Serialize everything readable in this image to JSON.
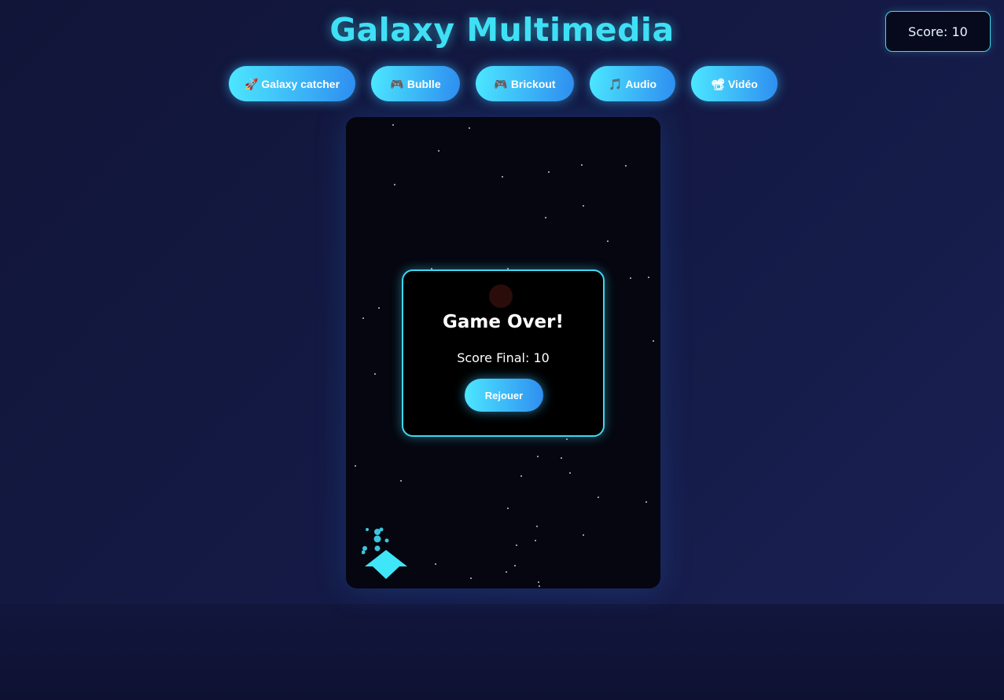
{
  "app": {
    "title": "Galaxy Multimedia",
    "score_label": "Score: 10"
  },
  "nav": {
    "items": [
      {
        "icon": "rocket-icon",
        "glyph": "🚀",
        "label": "Galaxy catcher"
      },
      {
        "icon": "gamepad-icon",
        "glyph": "🎮",
        "label": "Bublle"
      },
      {
        "icon": "gamepad-icon",
        "glyph": "🎮",
        "label": "Brickout"
      },
      {
        "icon": "music-note-icon",
        "glyph": "🎵",
        "label": "Audio"
      },
      {
        "icon": "film-projector-icon",
        "glyph": "📽",
        "label": "Vidéo"
      }
    ]
  },
  "game_over": {
    "title": "Game Over!",
    "final_score": "Score Final: 10",
    "replay_label": "Rejouer"
  },
  "colors": {
    "accent": "#3fe0f5",
    "button_gradient_start": "#4ce6ff",
    "button_gradient_end": "#2f8ff0",
    "canvas_bg": "#05060f",
    "page_bg": "#141a45"
  }
}
